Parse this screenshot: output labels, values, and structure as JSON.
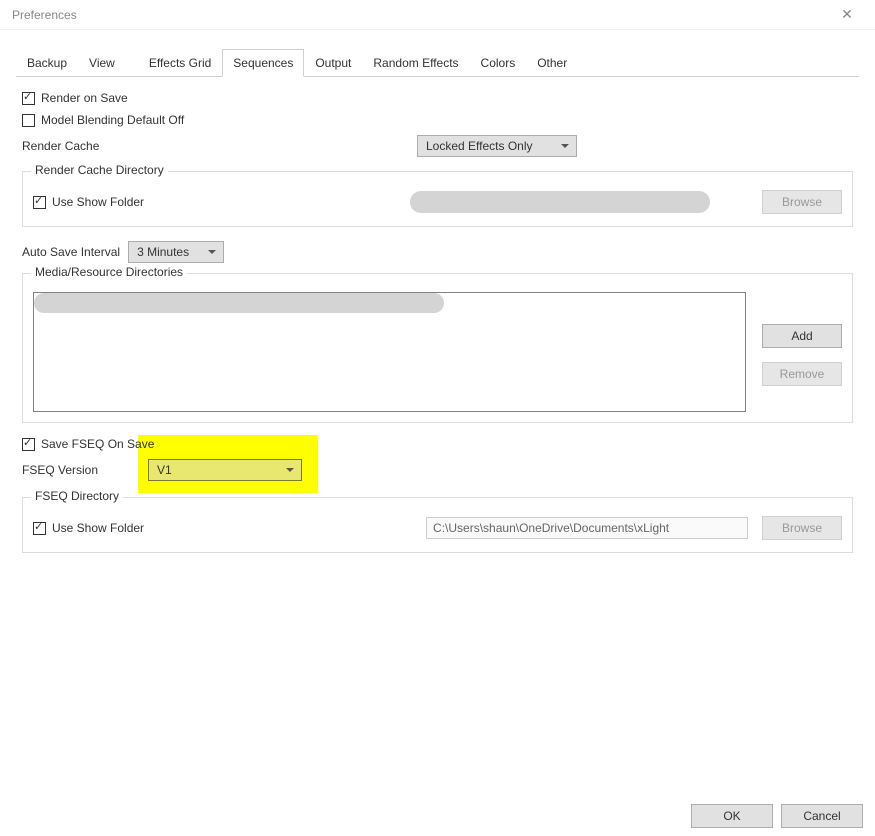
{
  "window": {
    "title": "Preferences"
  },
  "tabs": {
    "backup": "Backup",
    "view": "View",
    "effects_grid": "Effects Grid",
    "sequences": "Sequences",
    "output": "Output",
    "random_effects": "Random Effects",
    "colors": "Colors",
    "other": "Other"
  },
  "sequences_tab": {
    "render_on_save": "Render on Save",
    "model_blending_default_off": "Model Blending Default Off",
    "render_cache_label": "Render Cache",
    "render_cache_value": "Locked Effects Only",
    "render_cache_directory_legend": "Render Cache Directory",
    "use_show_folder_1": "Use Show Folder",
    "browse_1": "Browse",
    "auto_save_interval_label": "Auto Save Interval",
    "auto_save_interval_value": "3 Minutes",
    "media_resource_legend": "Media/Resource Directories",
    "add_btn": "Add",
    "remove_btn": "Remove",
    "save_fseq_on_save": "Save FSEQ On Save",
    "fseq_version_label": "FSEQ Version",
    "fseq_version_value": "V1",
    "fseq_directory_legend": "FSEQ Directory",
    "use_show_folder_2": "Use Show Folder",
    "fseq_path": "C:\\Users\\shaun\\OneDrive\\Documents\\xLight",
    "browse_2": "Browse"
  },
  "footer": {
    "ok": "OK",
    "cancel": "Cancel"
  }
}
